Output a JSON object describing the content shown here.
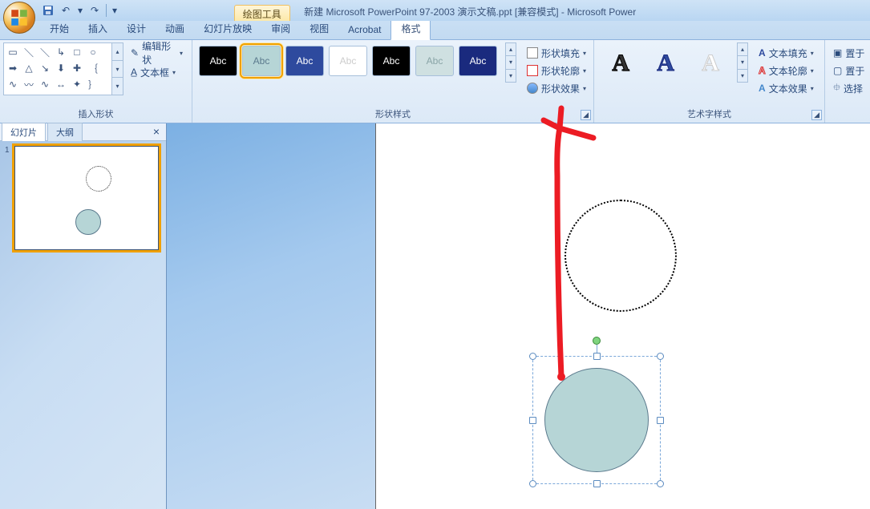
{
  "title": {
    "tool_context": "绘图工具",
    "document": "新建 Microsoft PowerPoint 97-2003 演示文稿.ppt [兼容模式] - Microsoft Power"
  },
  "qat": {
    "save": "保存",
    "undo": "撤消",
    "redo": "恢复"
  },
  "menu": {
    "home": "开始",
    "insert": "插入",
    "design": "设计",
    "anim": "动画",
    "slideshow": "幻灯片放映",
    "review": "审阅",
    "view": "视图",
    "acrobat": "Acrobat",
    "format": "格式"
  },
  "ribbon": {
    "insert_shapes_label": "插入形状",
    "edit_shape": "编辑形状",
    "text_box": "文本框",
    "shape_styles_label": "形状样式",
    "shape_fill": "形状填充",
    "shape_outline": "形状轮廓",
    "shape_effects": "形状效果",
    "wordart_label": "艺术字样式",
    "text_fill": "文本填充",
    "text_outline": "文本轮廓",
    "text_effects": "文本效果",
    "arrange_front": "置于",
    "arrange_back": "置于",
    "selection": "选择",
    "abc": "Abc"
  },
  "pane": {
    "slides": "幻灯片",
    "outline": "大纲",
    "slide_num": "1"
  },
  "styles": [
    {
      "bg": "#000000",
      "fg": "#ffffff"
    },
    {
      "bg": "#b6d5d6",
      "fg": "#5b7a8d",
      "selected": true
    },
    {
      "bg": "#2e4a9e",
      "fg": "#ffffff"
    },
    {
      "bg": "#ffffff",
      "fg": "#cccccc"
    },
    {
      "bg": "#000000",
      "fg": "#ffffff"
    },
    {
      "bg": "#cfe0e1",
      "fg": "#8aa5a7"
    },
    {
      "bg": "#1a2a7e",
      "fg": "#ffffff"
    }
  ]
}
